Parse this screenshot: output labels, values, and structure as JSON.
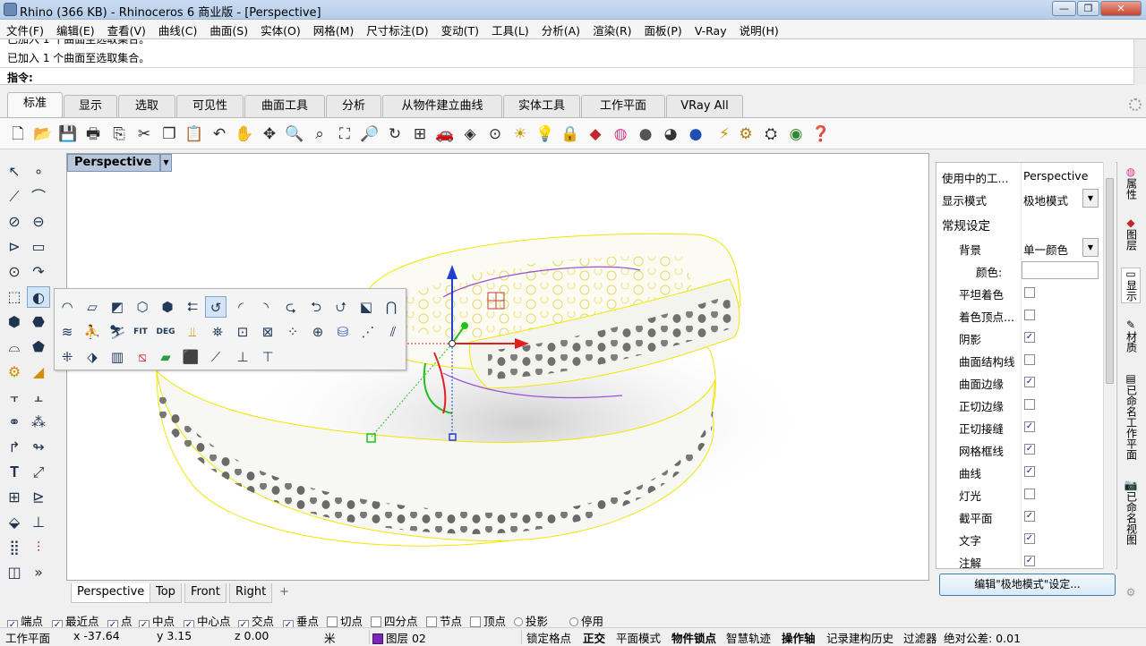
{
  "window": {
    "title": "Rhino (366 KB) - Rhinoceros 6 商业版 - [Perspective]",
    "buttons": [
      "—",
      "❐",
      "✕"
    ]
  },
  "menu": [
    "文件(F)",
    "编辑(E)",
    "查看(V)",
    "曲线(C)",
    "曲面(S)",
    "实体(O)",
    "网格(M)",
    "尺寸标注(D)",
    "变动(T)",
    "工具(L)",
    "分析(A)",
    "渲染(R)",
    "面板(P)",
    "V-Ray",
    "说明(H)"
  ],
  "command": {
    "history_partial": "已加入 1 个曲面至选取集合。",
    "history_last": "已加入 1 个曲面至选取集合。",
    "prompt_label": "指令:"
  },
  "toolbar_tabs": [
    "标准",
    "显示",
    "选取",
    "可见性",
    "曲面工具",
    "分析",
    "从物件建立曲线",
    "实体工具",
    "工作平面",
    "VRay All"
  ],
  "toolbar_icons": [
    "new-icon",
    "open-icon",
    "save-icon",
    "print-icon",
    "import-icon",
    "cut-icon",
    "copy-icon",
    "paste-icon",
    "undo-icon",
    "pan-icon",
    "rotate-view-icon",
    "zoom-window-icon",
    "zoom-dynamic-icon",
    "zoom-extents-icon",
    "zoom-selected-icon",
    "rotate-camera-icon",
    "four-views-icon",
    "car-icon",
    "cplane-icon",
    "grid-icon",
    "light-icon",
    "bulb-icon",
    "lock-icon",
    "material-icon",
    "color-wheel-icon",
    "sphere-gray-icon",
    "sphere-shaded-icon",
    "sphere-blue-icon",
    "render-icon",
    "gear-render-icon",
    "options-icon",
    "globe-icon",
    "help-icon"
  ],
  "viewport": {
    "name": "Perspective",
    "tabs": [
      "Perspective",
      "Top",
      "Front",
      "Right"
    ],
    "add_tab": "+"
  },
  "popup_text_labels": {
    "fit": "FIT",
    "deg": "DEG"
  },
  "panel": {
    "rows": [
      {
        "key": "使用中的工...",
        "value": "Perspective",
        "kind": "text"
      },
      {
        "key": "显示模式",
        "value": "极地模式",
        "kind": "dropdown"
      },
      {
        "key": "常规设定",
        "kind": "section"
      },
      {
        "key": "背景",
        "value": "单一颜色",
        "kind": "dropdown"
      },
      {
        "key": "颜色:",
        "kind": "color"
      },
      {
        "key": "平坦着色",
        "checked": false,
        "kind": "check"
      },
      {
        "key": "着色顶点...",
        "checked": false,
        "kind": "check"
      },
      {
        "key": "阴影",
        "checked": true,
        "kind": "check"
      },
      {
        "key": "曲面结构线",
        "checked": false,
        "kind": "check"
      },
      {
        "key": "曲面边缘",
        "checked": true,
        "kind": "check"
      },
      {
        "key": "正切边缘",
        "checked": false,
        "kind": "check"
      },
      {
        "key": "正切接缝",
        "checked": true,
        "kind": "check"
      },
      {
        "key": "网格框线",
        "checked": true,
        "kind": "check"
      },
      {
        "key": "曲线",
        "checked": true,
        "kind": "check"
      },
      {
        "key": "灯光",
        "checked": false,
        "kind": "check"
      },
      {
        "key": "截平面",
        "checked": true,
        "kind": "check"
      },
      {
        "key": "文字",
        "checked": true,
        "kind": "check"
      },
      {
        "key": "注解",
        "checked": true,
        "kind": "check"
      }
    ],
    "edit_button": "编辑\"极地模式\"设定...",
    "side_tabs": [
      "属性",
      "图层",
      "显示",
      "材质",
      "已命名工作平面",
      "已命名视图"
    ]
  },
  "osnap": [
    {
      "label": "端点",
      "checked": true
    },
    {
      "label": "最近点",
      "checked": true
    },
    {
      "label": "点",
      "checked": true
    },
    {
      "label": "中点",
      "checked": true
    },
    {
      "label": "中心点",
      "checked": true
    },
    {
      "label": "交点",
      "checked": true
    },
    {
      "label": "垂点",
      "checked": true
    },
    {
      "label": "切点",
      "checked": false
    },
    {
      "label": "四分点",
      "checked": false
    },
    {
      "label": "节点",
      "checked": false
    },
    {
      "label": "顶点",
      "checked": false
    },
    {
      "label": "投影",
      "checked": false,
      "radio": true
    },
    {
      "label": "停用",
      "checked": false,
      "radio": true
    }
  ],
  "status": {
    "cplane": "工作平面",
    "x": "x -37.64",
    "y": "y 3.15",
    "z": "z 0.00",
    "unit": "米",
    "layer": "图层 02",
    "layer_color": "#7a28b5",
    "grid_snap": "锁定格点",
    "ortho": "正交",
    "planar": "平面模式",
    "osnap": "物件锁点",
    "smart_track": "智慧轨迹",
    "gumball": "操作轴",
    "history": "记录建构历史",
    "filter": "过滤器",
    "tolerance": "绝对公差: 0.01"
  },
  "colors": {
    "object_highlight": "#f2e600",
    "gumball_x": "#e02020",
    "gumball_y": "#20c020",
    "gumball_z": "#2040d0",
    "viewport_title_bg": "#b8c7db"
  }
}
